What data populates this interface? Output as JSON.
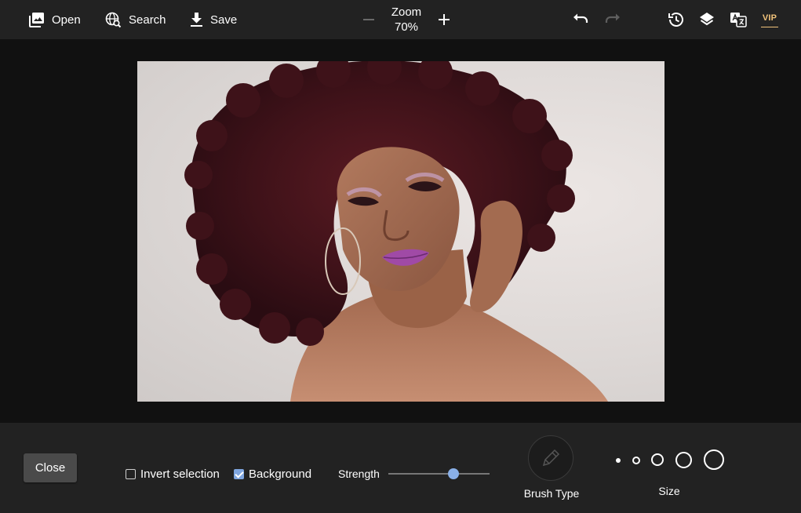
{
  "toolbar": {
    "open_label": "Open",
    "search_label": "Search",
    "save_label": "Save",
    "zoom_title": "Zoom",
    "zoom_value": "70%",
    "vip_label": "VIP"
  },
  "icons": {
    "open": "image-icon",
    "search": "globe-search-icon",
    "save": "download-icon",
    "zoom_out": "minus-icon",
    "zoom_in": "plus-icon",
    "undo": "undo-icon",
    "redo": "redo-icon",
    "history": "history-icon",
    "layers": "layers-icon",
    "translate": "translate-icon",
    "brush": "pencil-icon"
  },
  "colors": {
    "accent": "#7fa6e0",
    "vip": "#f0c27a",
    "toolbar_bg": "#222222",
    "canvas_bg": "#111111"
  },
  "panel": {
    "close_label": "Close",
    "invert_label": "Invert selection",
    "invert_checked": false,
    "background_label": "Background",
    "background_checked": true,
    "strength_label": "Strength",
    "strength_value": 0.64,
    "brush_type_label": "Brush Type",
    "size_label": "Size",
    "size_options": [
      "xs",
      "s",
      "m",
      "l",
      "xl"
    ]
  }
}
